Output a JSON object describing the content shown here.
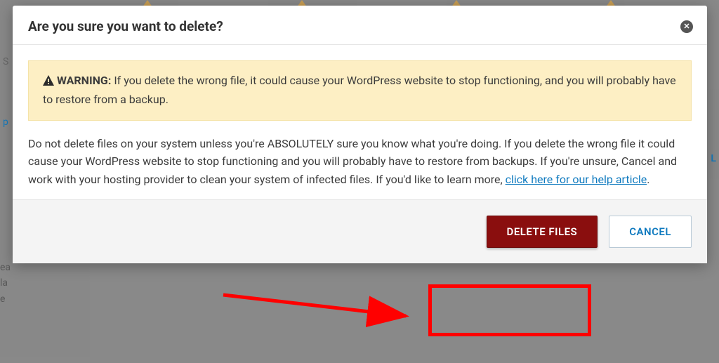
{
  "modal": {
    "title": "Are you sure you want to delete?",
    "warning_label": "WARNING:",
    "warning_text": " If you delete the wrong file, it could cause your WordPress website to stop functioning, and you will probably have to restore from a backup.",
    "body_text_before": "Do not delete files on your system unless you're ABSOLUTELY sure you know what you're doing. If you delete the wrong file it could cause your WordPress website to stop functioning and you will probably have to restore from backups. If you're unsure, Cancel and work with your hosting provider to clean your system of infected files. If you'd like to learn more, ",
    "help_link_text": "click here for our help article",
    "body_text_after": ".",
    "delete_label": "DELETE FILES",
    "cancel_label": "CANCEL"
  },
  "backdrop": {
    "left_char": "S",
    "left_char2": "p",
    "right_char": "L",
    "bottom_lines": "ea\nla\ne"
  }
}
